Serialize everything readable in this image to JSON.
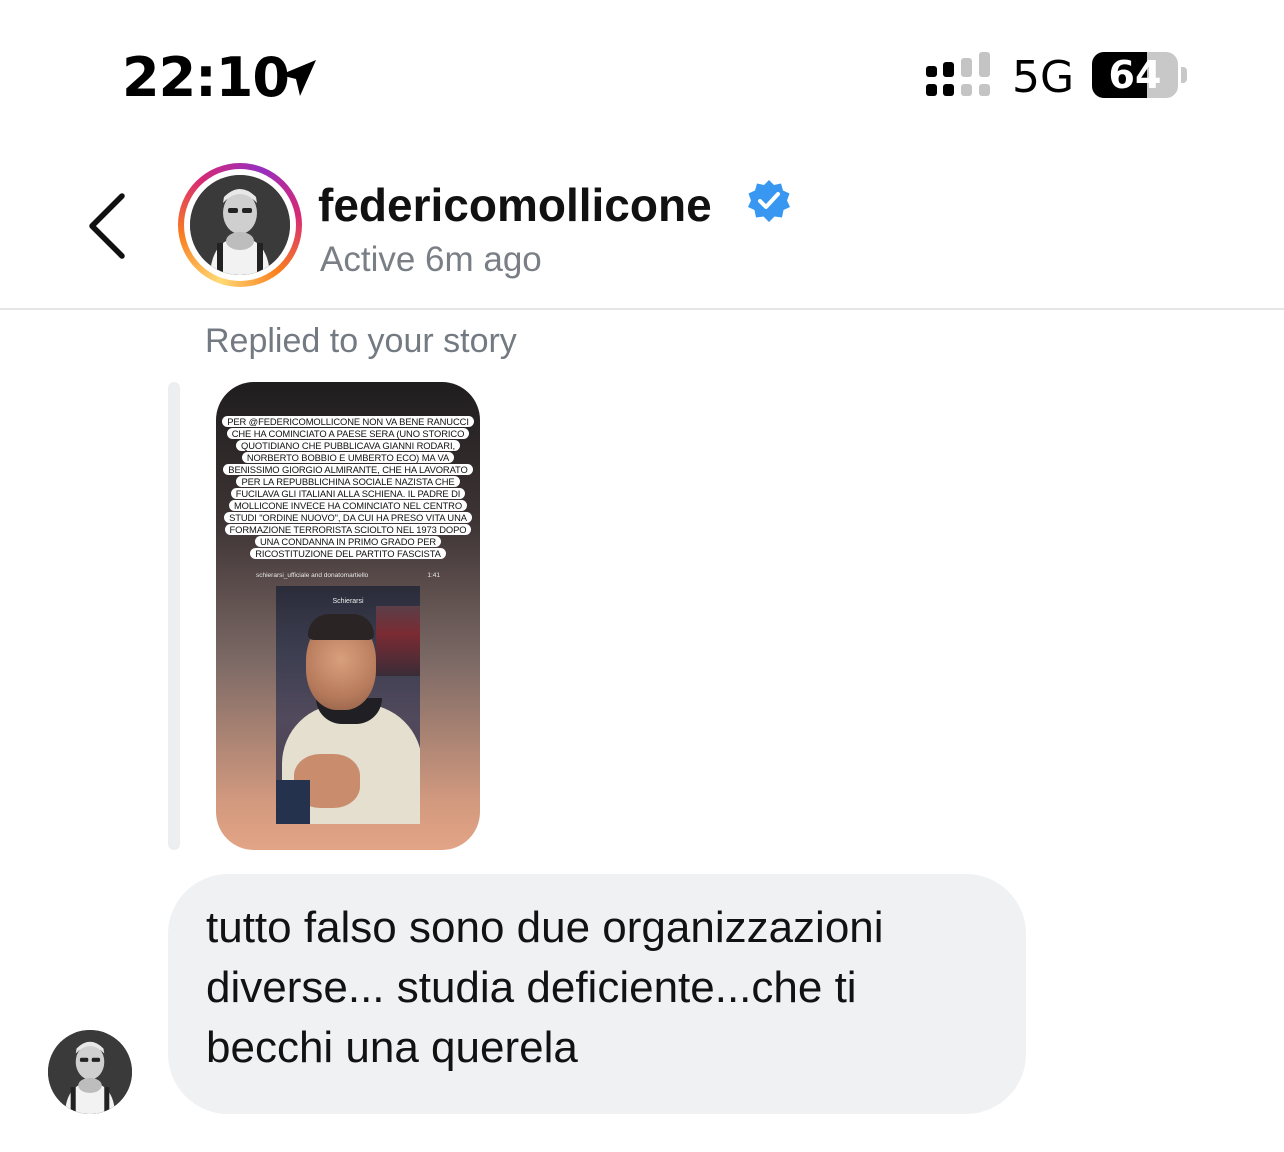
{
  "status_bar": {
    "time": "22:10",
    "network": "5G",
    "battery_percent": "64",
    "battery_level": 0.64,
    "icons": [
      "location-arrow-icon",
      "signal-bars-icon",
      "battery-icon"
    ]
  },
  "header": {
    "username": "federicomollicone",
    "verified": true,
    "active_status": "Active 6m ago",
    "icons": [
      "chevron-left-icon",
      "verified-badge-icon"
    ],
    "colors": {
      "verified": "#3897f0",
      "ring_start": "#feda75",
      "ring_end": "#d62976"
    }
  },
  "conversation": {
    "reply_label": "Replied to your story",
    "story": {
      "text_lines": [
        "PER @FEDERICOMOLLICONE NON VA BENE RANUCCI",
        "CHE HA COMINCIATO A PAESE SERA (UNO STORICO",
        "QUOTIDIANO CHE PUBBLICAVA GIANNI RODARI,",
        "NORBERTO BOBBIO E UMBERTO ECO) MA VA",
        "BENISSIMO GIORGIO ALMIRANTE, CHE HA LAVORATO",
        "PER LA REPUBBLICHINA SOCIALE NAZISTA CHE",
        "FUCILAVA GLI ITALIANI ALLA SCHIENA. IL PADRE DI",
        "MOLLICONE INVECE HA COMINCIATO NEL CENTRO",
        "STUDI \"ORDINE NUOVO\", DA CUI HA PRESO VITA UNA",
        "FORMAZIONE TERRORISTA SCIOLTO NEL 1973 DOPO",
        "UNA CONDANNA IN PRIMO GRADO PER",
        "RICOSTITUZIONE DEL PARTITO FASCISTA"
      ],
      "video_caption": "schierarsi_ufficiale and donatomartiello",
      "video_duration": "1:41",
      "video_logo": "Schierarsi"
    },
    "message": "tutto falso  sono due organizzazioni diverse... studia deficiente...che ti becchi una querela"
  }
}
